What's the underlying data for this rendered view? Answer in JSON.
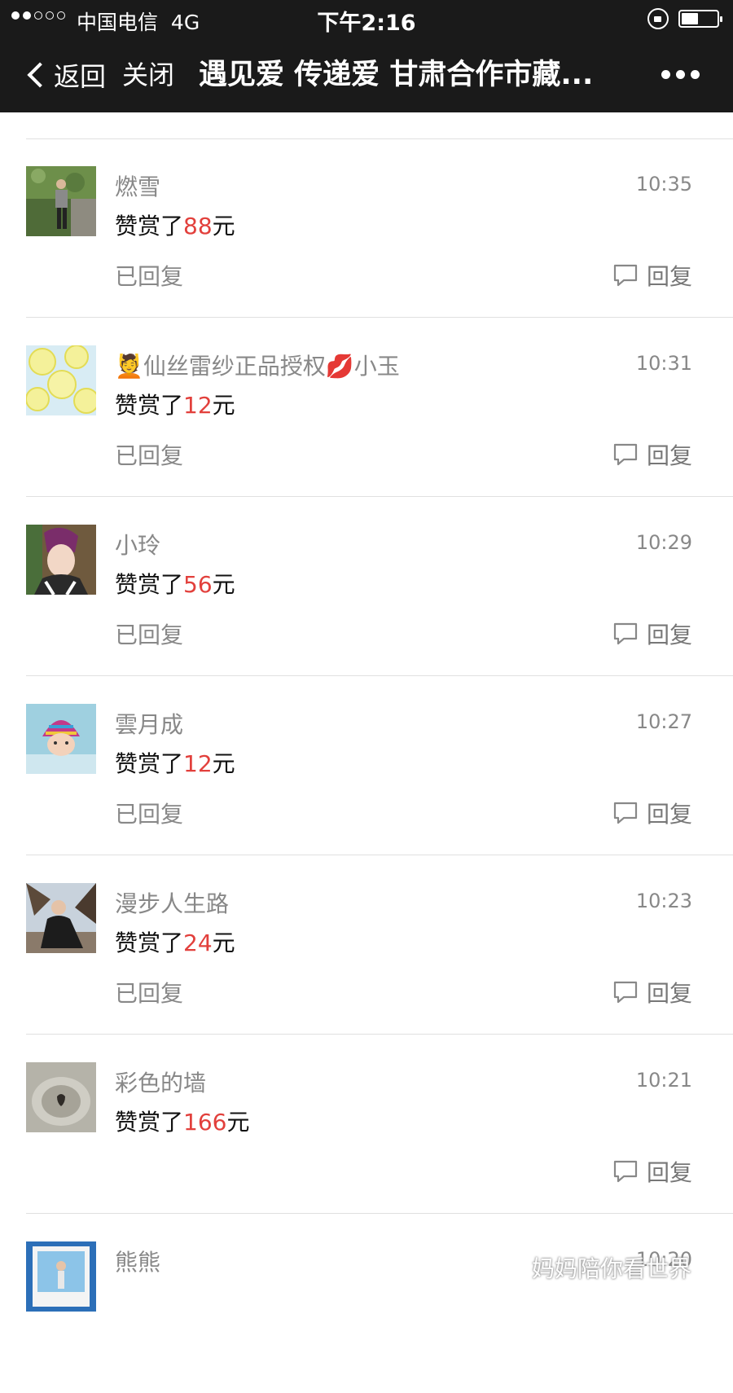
{
  "status_bar": {
    "carrier": "中国电信",
    "network": "4G",
    "time": "下午2:16"
  },
  "nav": {
    "back_label": "返回",
    "close_label": "关闭",
    "title": "遇见爱 传递爱 甘肃合作市藏..."
  },
  "rewards": [
    {
      "name": "燃雪",
      "time": "10:35",
      "prefix": "赞赏了",
      "amount": "88",
      "suffix": "元",
      "replied": "已回复",
      "reply": "回复"
    },
    {
      "name": "仙丝雷纱正品授权",
      "name_suffix": "小玉",
      "time": "10:31",
      "prefix": "赞赏了",
      "amount": "12",
      "suffix": "元",
      "replied": "已回复",
      "reply": "回复"
    },
    {
      "name": "小玲",
      "time": "10:29",
      "prefix": "赞赏了",
      "amount": "56",
      "suffix": "元",
      "replied": "已回复",
      "reply": "回复"
    },
    {
      "name": "雲月成",
      "time": "10:27",
      "prefix": "赞赏了",
      "amount": "12",
      "suffix": "元",
      "replied": "已回复",
      "reply": "回复"
    },
    {
      "name": "漫步人生路",
      "time": "10:23",
      "prefix": "赞赏了",
      "amount": "24",
      "suffix": "元",
      "replied": "已回复",
      "reply": "回复"
    },
    {
      "name": "彩色的墙",
      "time": "10:21",
      "prefix": "赞赏了",
      "amount": "166",
      "suffix": "元",
      "replied": "",
      "reply": "回复"
    },
    {
      "name": "熊熊",
      "time": "10:20"
    }
  ],
  "watermark": "妈妈陪你看世界",
  "colors": {
    "nav_bg": "#1a1a1a",
    "amount": "#e2403c",
    "muted": "#888888"
  }
}
